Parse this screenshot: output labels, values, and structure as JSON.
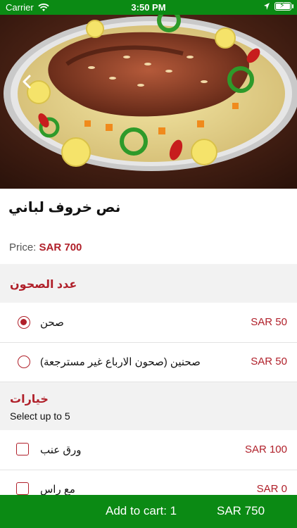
{
  "status_bar": {
    "carrier": "Carrier",
    "time": "3:50 PM"
  },
  "product": {
    "title": "نص خروف لباني",
    "price_label": "Price:",
    "price_value": "SAR 700"
  },
  "sections": [
    {
      "title": "عدد الصحون",
      "options": [
        {
          "label": "صحن",
          "price": "SAR 50",
          "selected": true
        },
        {
          "label": "صحنين (صحون الارباع غير مسترجعة)",
          "price": "SAR 50",
          "selected": false
        }
      ]
    },
    {
      "title": "خيارات",
      "subtitle": "Select up to 5",
      "options": [
        {
          "label": "ورق عنب",
          "price": "SAR 100",
          "checked": false
        },
        {
          "label": "مع راس",
          "price": "SAR 0",
          "checked": false
        }
      ]
    }
  ],
  "cart": {
    "label": "Add to cart: 1",
    "total": "SAR 750"
  },
  "colors": {
    "brand_green": "#0b8a14",
    "accent_red": "#b0202a"
  }
}
